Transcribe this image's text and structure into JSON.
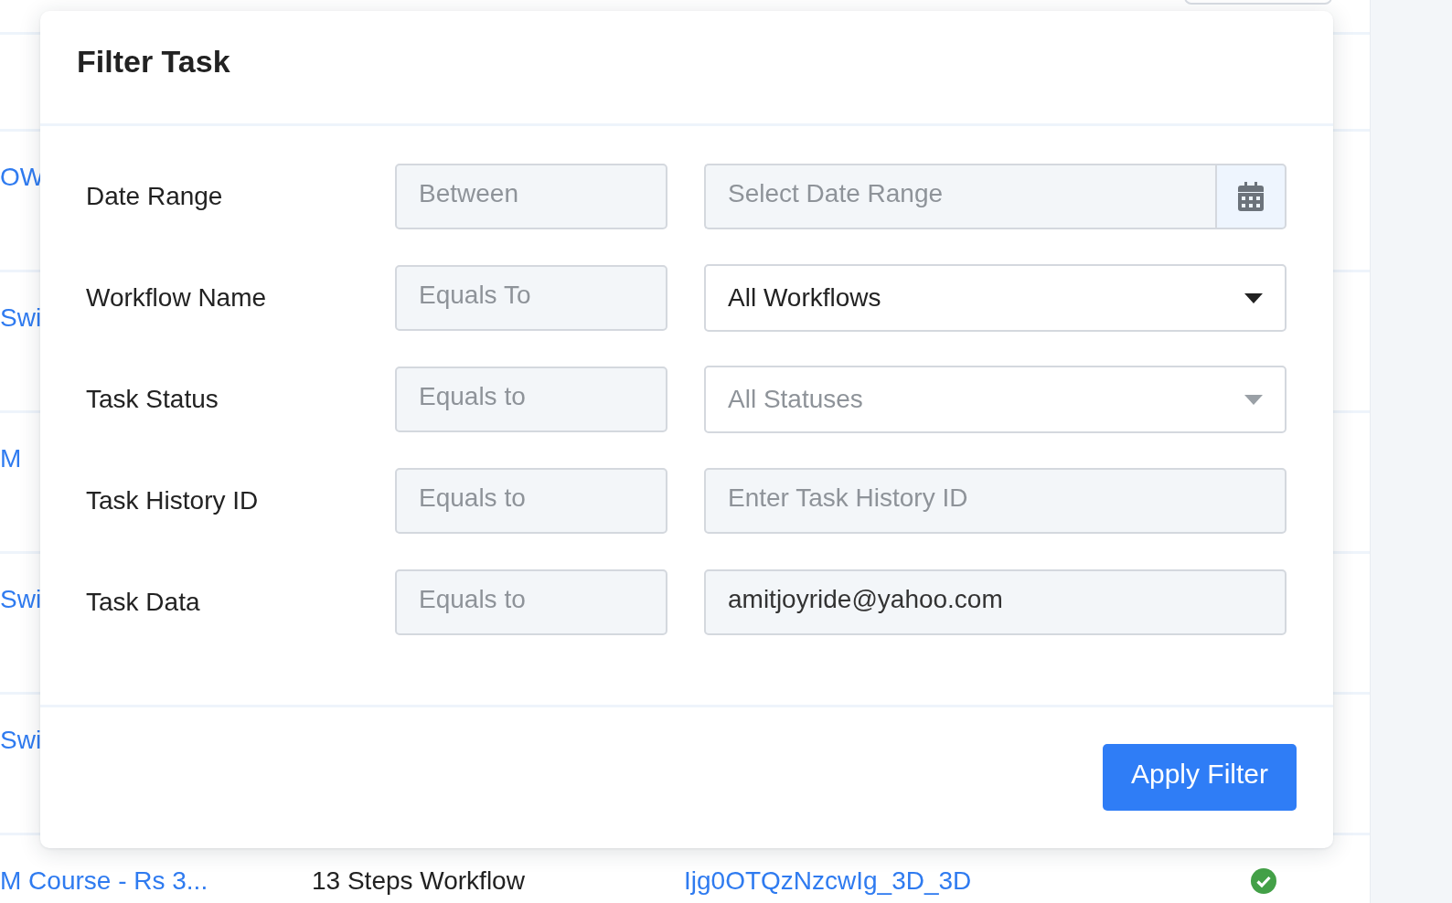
{
  "background_table": {
    "rows": [
      {
        "name": "OW"
      },
      {
        "name": "Swi"
      },
      {
        "name": "M"
      },
      {
        "name": "Swi"
      },
      {
        "name": "Swi"
      },
      {
        "name": "M Course - Rs 3...",
        "workflow": "13 Steps Workflow",
        "task_id": "Ijg0OTQzNzcwIg_3D_3D",
        "status_ok": true
      }
    ]
  },
  "dialog": {
    "title": "Filter Task",
    "filters": [
      {
        "label": "Date Range",
        "operator": "Between",
        "kind": "date",
        "placeholder": "Select Date Range"
      },
      {
        "label": "Workflow Name",
        "operator": "Equals To",
        "kind": "select",
        "value": "All Workflows"
      },
      {
        "label": "Task Status",
        "operator": "Equals to",
        "kind": "select",
        "placeholder": "All Statuses"
      },
      {
        "label": "Task History ID",
        "operator": "Equals to",
        "kind": "text",
        "placeholder": "Enter Task History ID"
      },
      {
        "label": "Task Data",
        "operator": "Equals to",
        "kind": "text",
        "value": "amitjoyride@yahoo.com"
      }
    ],
    "apply_button": "Apply Filter"
  }
}
